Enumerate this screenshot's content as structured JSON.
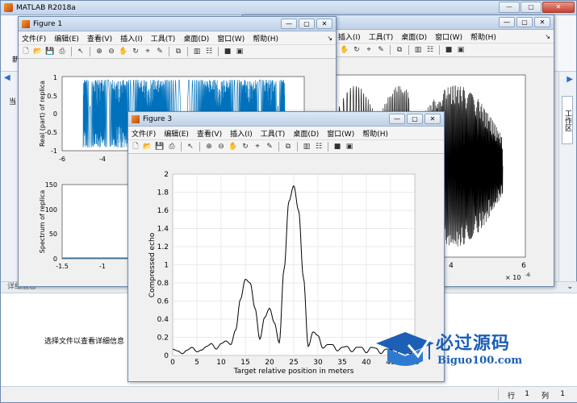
{
  "app": {
    "title": "MATLAB R2018a",
    "toolstrip_left_label": "新",
    "left_panel_label": "当",
    "right_panel_tab": "工作区",
    "detail_header": "详细信息",
    "detail_message": "选择文件以查看详细信息",
    "status_row_label": "行",
    "status_row_value": "1",
    "status_col_label": "列",
    "status_col_value": "1"
  },
  "window_buttons": {
    "minimize": "—",
    "restore": "▢",
    "close": "✕"
  },
  "figure_menu": [
    "文件(F)",
    "编辑(E)",
    "查看(V)",
    "插入(I)",
    "工具(T)",
    "桌面(D)",
    "窗口(W)",
    "帮助(H)"
  ],
  "figure_menu_back": [
    "插入(I)",
    "工具(T)",
    "桌面(D)",
    "窗口(W)",
    "帮助(H)"
  ],
  "toolbar_icons": [
    "new-icon",
    "open-icon",
    "save-icon",
    "print-icon",
    "pointer-icon",
    "zoom-in-icon",
    "zoom-out-icon",
    "pan-icon",
    "rotate-icon",
    "datacursor-icon",
    "brush-icon",
    "link-icon",
    "colorbar-icon",
    "legend-icon",
    "hide-plot-icon",
    "show-plot-icon"
  ],
  "figure1": {
    "title": "Figure 1",
    "top_plot": {
      "ylabel": "Real (part) of replica",
      "yticks": [
        "1",
        "0.5",
        "0",
        "-0.5",
        "-1"
      ],
      "xticks": [
        "-6",
        "-4"
      ]
    },
    "bottom_plot": {
      "ylabel": "Spectrum of replica",
      "yticks": [
        "150",
        "100",
        "50",
        "0"
      ],
      "xticks": [
        "-1.5",
        "-1"
      ]
    }
  },
  "figure2": {
    "xticks": [
      "4",
      "6"
    ],
    "exponent": "× 10",
    "exponent_power": "-6"
  },
  "figure3": {
    "title": "Figure 3",
    "chart_data": {
      "type": "line",
      "xlabel": "Target relative position in meters",
      "ylabel": "Compressed echo",
      "xlim": [
        0,
        50
      ],
      "ylim": [
        0,
        2
      ],
      "xticks": [
        "0",
        "5",
        "10",
        "15",
        "20",
        "25",
        "30",
        "35",
        "40",
        "45",
        "50"
      ],
      "yticks": [
        "0",
        "0.2",
        "0.4",
        "0.6",
        "0.8",
        "1",
        "1.2",
        "1.4",
        "1.6",
        "1.8",
        "2"
      ],
      "grid": true,
      "color": "#000000",
      "x": [
        0,
        1,
        2,
        3,
        4,
        5,
        6,
        7,
        8,
        9,
        10,
        11,
        12,
        13,
        14,
        15,
        16,
        17,
        18,
        19,
        20,
        21,
        22,
        23,
        24,
        25,
        26,
        27,
        28,
        29,
        30,
        31,
        32,
        33,
        34,
        35,
        36,
        37,
        38,
        39,
        40,
        41,
        42,
        43,
        44,
        45,
        46,
        47,
        48,
        49,
        50
      ],
      "y": [
        0.07,
        0.05,
        0.02,
        0.06,
        0.09,
        0.04,
        0.06,
        0.1,
        0.13,
        0.07,
        0.13,
        0.16,
        0.12,
        0.28,
        0.62,
        0.84,
        0.8,
        0.52,
        0.18,
        0.42,
        0.52,
        0.36,
        0.14,
        0.95,
        1.7,
        1.87,
        1.6,
        0.86,
        0.1,
        0.26,
        0.22,
        0.08,
        0.12,
        0.12,
        0.05,
        0.09,
        0.1,
        0.04,
        0.09,
        0.09,
        0.03,
        0.09,
        0.08,
        0.02,
        0.07,
        0.07,
        0.02,
        0.06,
        0.05,
        0.02,
        0.06
      ]
    }
  },
  "watermark": {
    "big": "必过源码",
    "small": "Biguo100.com"
  }
}
